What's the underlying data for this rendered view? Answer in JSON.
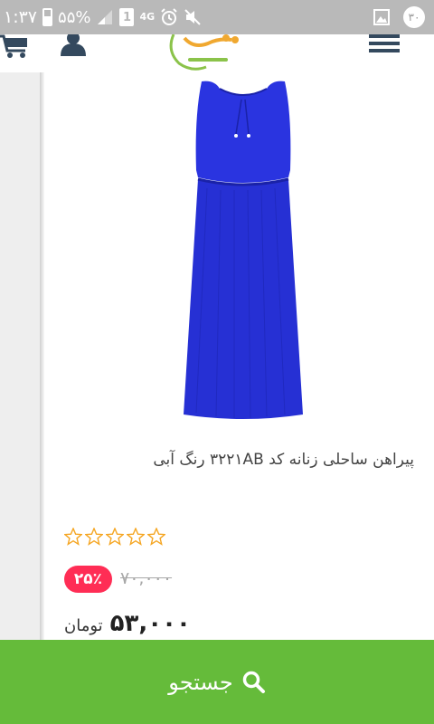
{
  "status_bar": {
    "time": "۱:۳۷",
    "battery": "۵۵%",
    "network": "4G",
    "sim_slot": "1",
    "notification_count": "۳۰",
    "icons": [
      "battery-icon",
      "signal-icon",
      "sim-icon",
      "alarm-icon",
      "mute-icon",
      "gallery-icon"
    ]
  },
  "header": {
    "icons": [
      "cart-icon",
      "user-icon",
      "logo",
      "hamburger-menu-icon"
    ]
  },
  "product": {
    "title": "پیراهن ساحلی زنانه کد ۳۲۲۱AB رنگ آبی",
    "rating": 0,
    "rating_max": 5,
    "discount": "۲۵٪",
    "old_price": "۷۰,۰۰۰",
    "price": "۵۳,۰۰۰",
    "currency": "تومان",
    "image_color": "#2a34e0"
  },
  "search_bar": {
    "label": "جستجو",
    "icon": "search-icon",
    "color": "#65bb3a"
  }
}
